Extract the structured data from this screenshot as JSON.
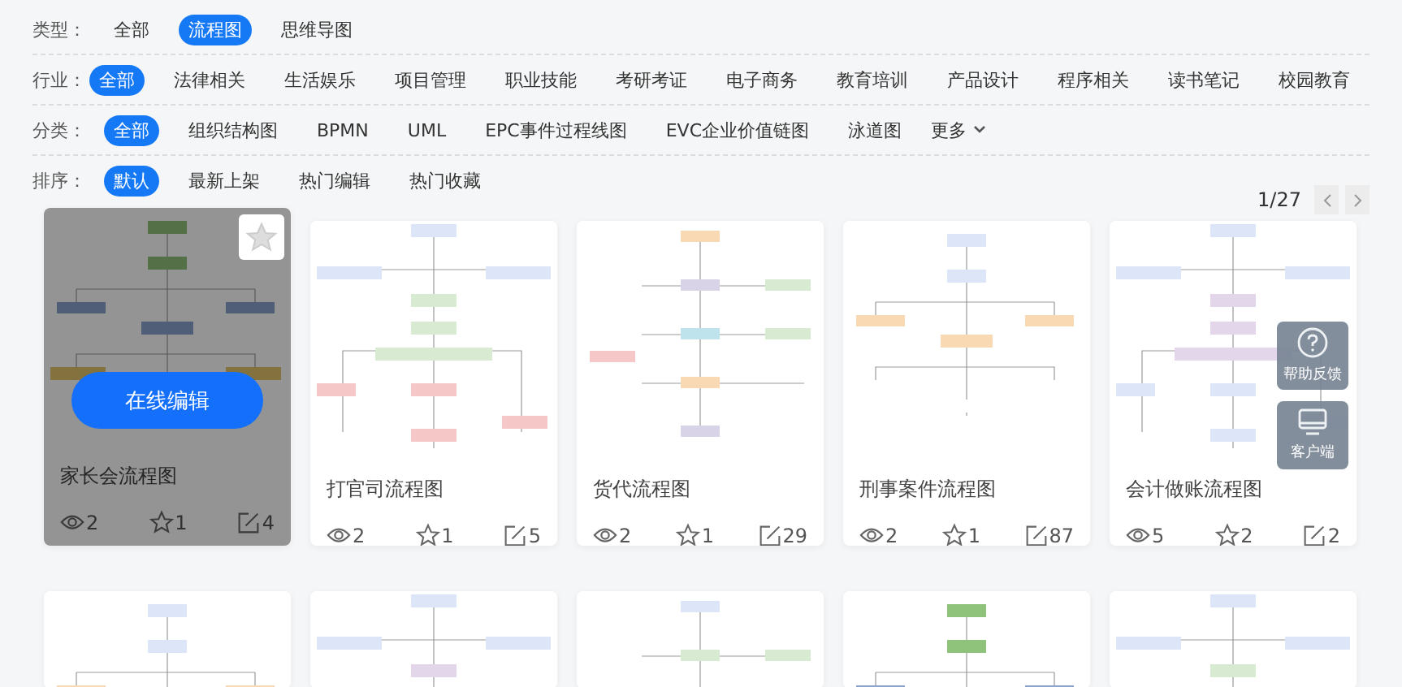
{
  "filters": [
    {
      "label": "类型：",
      "options": [
        {
          "label": "全部",
          "selected": false
        },
        {
          "label": "流程图",
          "selected": true
        },
        {
          "label": "思维导图",
          "selected": false
        }
      ]
    },
    {
      "label": "行业：",
      "options": [
        {
          "label": "全部",
          "selected": true
        },
        {
          "label": "法律相关",
          "selected": false
        },
        {
          "label": "生活娱乐",
          "selected": false
        },
        {
          "label": "项目管理",
          "selected": false
        },
        {
          "label": "职业技能",
          "selected": false
        },
        {
          "label": "考研考证",
          "selected": false
        },
        {
          "label": "电子商务",
          "selected": false
        },
        {
          "label": "教育培训",
          "selected": false
        },
        {
          "label": "产品设计",
          "selected": false
        },
        {
          "label": "程序相关",
          "selected": false
        },
        {
          "label": "读书笔记",
          "selected": false
        },
        {
          "label": "校园教育",
          "selected": false
        }
      ]
    },
    {
      "label": "分类：",
      "options": [
        {
          "label": "全部",
          "selected": true
        },
        {
          "label": "组织结构图",
          "selected": false
        },
        {
          "label": "BPMN",
          "selected": false
        },
        {
          "label": "UML",
          "selected": false
        },
        {
          "label": "EPC事件过程线图",
          "selected": false
        },
        {
          "label": "EVC企业价值链图",
          "selected": false
        },
        {
          "label": "泳道图",
          "selected": false
        }
      ],
      "more": "更多"
    },
    {
      "label": "排序：",
      "options": [
        {
          "label": "默认",
          "selected": true
        },
        {
          "label": "最新上架",
          "selected": false
        },
        {
          "label": "热门编辑",
          "selected": false
        },
        {
          "label": "热门收藏",
          "selected": false
        }
      ]
    }
  ],
  "pagination": {
    "page": "1/27"
  },
  "cards": [
    {
      "title": "家长会流程图",
      "views": "2",
      "favorites": "1",
      "edits": "4",
      "hovered": true
    },
    {
      "title": "打官司流程图",
      "views": "2",
      "favorites": "1",
      "edits": "5",
      "hovered": false
    },
    {
      "title": "货代流程图",
      "views": "2",
      "favorites": "1",
      "edits": "29",
      "hovered": false
    },
    {
      "title": "刑事案件流程图",
      "views": "2",
      "favorites": "1",
      "edits": "87",
      "hovered": false
    },
    {
      "title": "会计做账流程图",
      "views": "5",
      "favorites": "2",
      "edits": "2",
      "hovered": false
    }
  ],
  "hover_action": "在线编辑",
  "float_buttons": [
    {
      "kind": "help",
      "label": "帮助反馈"
    },
    {
      "kind": "desktop",
      "label": "客户端"
    }
  ]
}
